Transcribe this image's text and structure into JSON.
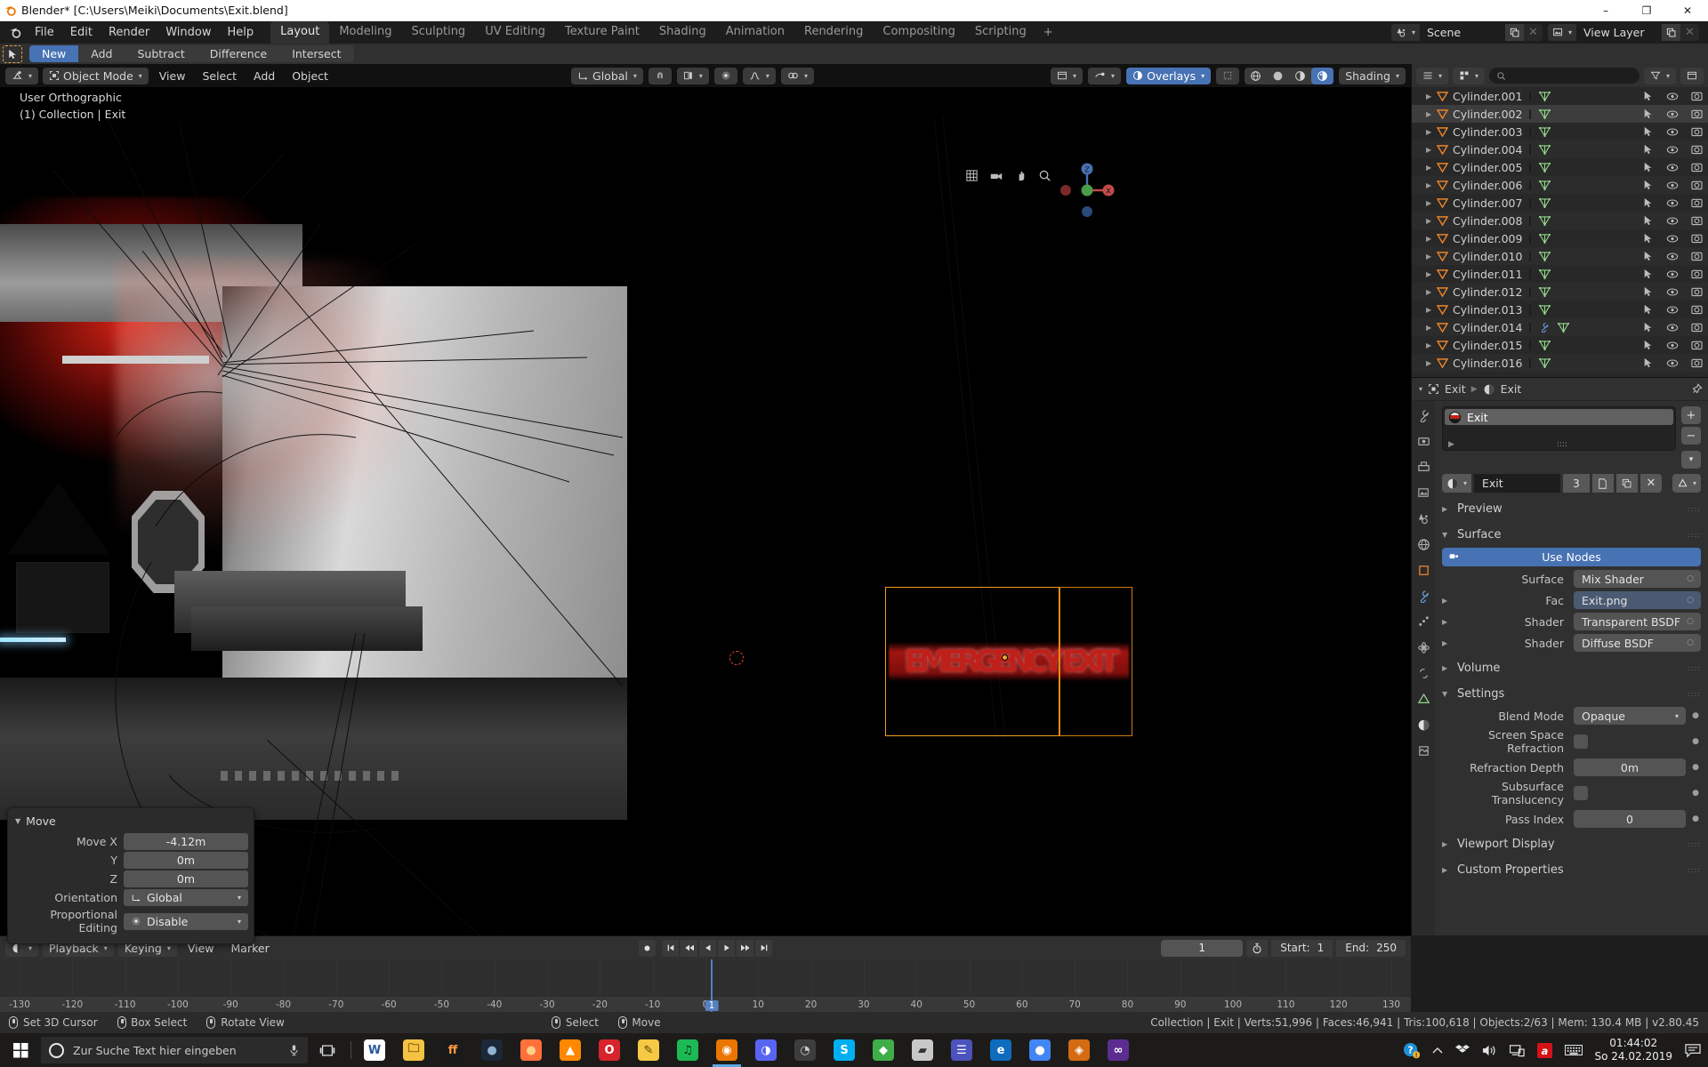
{
  "window": {
    "title": "Blender* [C:\\Users\\Meiki\\Documents\\Exit.blend]",
    "minimize": "–",
    "maximize": "❐",
    "close": "✕"
  },
  "topbar": {
    "menus": [
      "File",
      "Edit",
      "Render",
      "Window",
      "Help"
    ],
    "tabs": [
      {
        "label": "Layout",
        "active": true
      },
      {
        "label": "Modeling",
        "active": false
      },
      {
        "label": "Sculpting",
        "active": false
      },
      {
        "label": "UV Editing",
        "active": false
      },
      {
        "label": "Texture Paint",
        "active": false
      },
      {
        "label": "Shading",
        "active": false
      },
      {
        "label": "Animation",
        "active": false
      },
      {
        "label": "Rendering",
        "active": false
      },
      {
        "label": "Compositing",
        "active": false
      },
      {
        "label": "Scripting",
        "active": false
      }
    ],
    "add_tab": "+",
    "scene_label": "Scene",
    "viewlayer_label": "View Layer"
  },
  "toolheader": {
    "buttons": [
      {
        "label": "New",
        "active": true
      },
      {
        "label": "Add",
        "active": false
      },
      {
        "label": "Subtract",
        "active": false
      },
      {
        "label": "Difference",
        "active": false
      },
      {
        "label": "Intersect",
        "active": false
      }
    ]
  },
  "viewport": {
    "mode": "Object Mode",
    "menus": [
      "View",
      "Select",
      "Add",
      "Object"
    ],
    "transform_orientation": "Global",
    "overlays_label": "Overlays",
    "shading_label": "Shading",
    "overlay_text_line1": "User Orthographic",
    "overlay_text_line2": "(1) Collection | Exit",
    "sign_text": "EMERGENCY EXIT",
    "gizmo_axes": [
      "X",
      "Y",
      "Z"
    ]
  },
  "outliner": {
    "search_placeholder": "",
    "items": [
      {
        "name": "Cylinder.001",
        "selected": false,
        "modifier": false
      },
      {
        "name": "Cylinder.002",
        "selected": true,
        "modifier": false
      },
      {
        "name": "Cylinder.003",
        "selected": false,
        "modifier": false
      },
      {
        "name": "Cylinder.004",
        "selected": false,
        "modifier": false
      },
      {
        "name": "Cylinder.005",
        "selected": false,
        "modifier": false
      },
      {
        "name": "Cylinder.006",
        "selected": false,
        "modifier": false
      },
      {
        "name": "Cylinder.007",
        "selected": false,
        "modifier": false
      },
      {
        "name": "Cylinder.008",
        "selected": false,
        "modifier": false
      },
      {
        "name": "Cylinder.009",
        "selected": false,
        "modifier": false
      },
      {
        "name": "Cylinder.010",
        "selected": false,
        "modifier": false
      },
      {
        "name": "Cylinder.011",
        "selected": false,
        "modifier": false
      },
      {
        "name": "Cylinder.012",
        "selected": false,
        "modifier": false
      },
      {
        "name": "Cylinder.013",
        "selected": false,
        "modifier": false
      },
      {
        "name": "Cylinder.014",
        "selected": false,
        "modifier": true
      },
      {
        "name": "Cylinder.015",
        "selected": false,
        "modifier": false
      },
      {
        "name": "Cylinder.016",
        "selected": false,
        "modifier": false
      }
    ]
  },
  "properties": {
    "breadcrumb_object": "Exit",
    "breadcrumb_material": "Exit",
    "slot_name": "Exit",
    "material_name": "Exit",
    "material_users": "3",
    "panels": {
      "preview": "Preview",
      "surface": "Surface",
      "volume": "Volume",
      "settings": "Settings",
      "viewport_display": "Viewport Display",
      "custom_properties": "Custom Properties"
    },
    "use_nodes": "Use Nodes",
    "surface_rows": [
      {
        "label": "Surface",
        "value": "Mix Shader",
        "expand": false,
        "link": false
      },
      {
        "label": "Fac",
        "value": "Exit.png",
        "expand": true,
        "link": true
      },
      {
        "label": "Shader",
        "value": "Transparent BSDF",
        "expand": true,
        "link": false
      },
      {
        "label": "Shader",
        "value": "Diffuse BSDF",
        "expand": true,
        "link": false
      }
    ],
    "settings_rows": [
      {
        "label": "Blend Mode",
        "value": "Opaque",
        "type": "enum"
      },
      {
        "label": "Screen Space Refraction",
        "value": "",
        "type": "checkbox"
      },
      {
        "label": "Refraction Depth",
        "value": "0m",
        "type": "number"
      },
      {
        "label": "Subsurface Translucency",
        "value": "",
        "type": "checkbox"
      },
      {
        "label": "Pass Index",
        "value": "0",
        "type": "number"
      }
    ]
  },
  "redo_panel": {
    "title": "Move",
    "rows": [
      {
        "label": "Move X",
        "value": "-4.12m"
      },
      {
        "label": "Y",
        "value": "0m"
      },
      {
        "label": "Z",
        "value": "0m"
      }
    ],
    "orientation_label": "Orientation",
    "orientation_value": "Global",
    "proportional_label": "Proportional Editing",
    "proportional_value": "Disable"
  },
  "timeline": {
    "menus": [
      "Playback",
      "Keying",
      "View",
      "Marker"
    ],
    "current_frame": "1",
    "start_label": "Start:",
    "start_value": "1",
    "end_label": "End:",
    "end_value": "250",
    "ticks": [
      "-130",
      "-120",
      "-110",
      "-100",
      "-90",
      "-80",
      "-70",
      "-60",
      "-50",
      "-40",
      "-30",
      "-20",
      "-10",
      "0",
      "10",
      "20",
      "30",
      "40",
      "50",
      "60",
      "70",
      "80",
      "90",
      "100",
      "110",
      "120",
      "130"
    ],
    "playhead_frame": "1"
  },
  "statusbar": {
    "keymap": [
      {
        "label": "Set 3D Cursor",
        "button": "left"
      },
      {
        "label": "Box Select",
        "button": "left-drag"
      },
      {
        "label": "Rotate View",
        "button": "middle"
      },
      {
        "label": "Select",
        "button": "left"
      },
      {
        "label": "Move",
        "button": "left-drag"
      }
    ],
    "stats": "Collection | Exit | Verts:51,996 | Faces:46,941 | Tris:100,618 | Objects:2/63 | Mem: 130.4 MB | v2.80.45"
  },
  "taskbar": {
    "search_placeholder": "Zur Suche Text hier eingeben",
    "apps": [
      {
        "name": "word-app",
        "glyph": "W",
        "color": "#ffffff",
        "fg": "#2b579a",
        "active": false
      },
      {
        "name": "file-explorer-app",
        "glyph": "🗀",
        "color": "#f5c242",
        "fg": "#6b4a00",
        "active": false
      },
      {
        "name": "fontforge-app",
        "glyph": "ff",
        "color": "#1a1a1a",
        "fg": "#ff9a3c",
        "active": false
      },
      {
        "name": "steam-app",
        "glyph": "●",
        "color": "#1b2838",
        "fg": "#8fb3d0",
        "active": false
      },
      {
        "name": "firefox-app",
        "glyph": "●",
        "color": "#ff7139",
        "fg": "#ffd08a",
        "active": false
      },
      {
        "name": "vlc-app",
        "glyph": "▲",
        "color": "#ff8800",
        "fg": "#ffffff",
        "active": false
      },
      {
        "name": "opera-app",
        "glyph": "O",
        "color": "#d6232c",
        "fg": "#ffffff",
        "active": false
      },
      {
        "name": "notepad-app",
        "glyph": "✎",
        "color": "#f6c945",
        "fg": "#5a4100",
        "active": false
      },
      {
        "name": "spotify-app",
        "glyph": "♫",
        "color": "#1db954",
        "fg": "#052e14",
        "active": false
      },
      {
        "name": "blender-app",
        "glyph": "◉",
        "color": "#ea7600",
        "fg": "#ffffff",
        "active": true
      },
      {
        "name": "discord-app",
        "glyph": "◑",
        "color": "#5865f2",
        "fg": "#ffffff",
        "active": false
      },
      {
        "name": "krita-app",
        "glyph": "◔",
        "color": "#3d3d3d",
        "fg": "#c9c9c9",
        "active": false
      },
      {
        "name": "skype-app",
        "glyph": "S",
        "color": "#00aff0",
        "fg": "#ffffff",
        "active": false
      },
      {
        "name": "substance-app",
        "glyph": "◆",
        "color": "#3fae49",
        "fg": "#ffffff",
        "active": false
      },
      {
        "name": "photoshop-app",
        "glyph": "▰",
        "color": "#c8c8c8",
        "fg": "#333333",
        "active": false
      },
      {
        "name": "teams-app",
        "glyph": "☰",
        "color": "#4b53bc",
        "fg": "#ffffff",
        "active": false
      },
      {
        "name": "edge-app",
        "glyph": "e",
        "color": "#0f6cbd",
        "fg": "#ffffff",
        "active": false
      },
      {
        "name": "chrome-app",
        "glyph": "●",
        "color": "#4285f4",
        "fg": "#ffffff",
        "active": false
      },
      {
        "name": "unity-app",
        "glyph": "◈",
        "color": "#d46a12",
        "fg": "#ffffff",
        "active": false
      },
      {
        "name": "visualstudio-app",
        "glyph": "∞",
        "color": "#5c2d91",
        "fg": "#ffffff",
        "active": false
      }
    ],
    "time": "01:44:02",
    "date": "So 24.02.2019"
  }
}
